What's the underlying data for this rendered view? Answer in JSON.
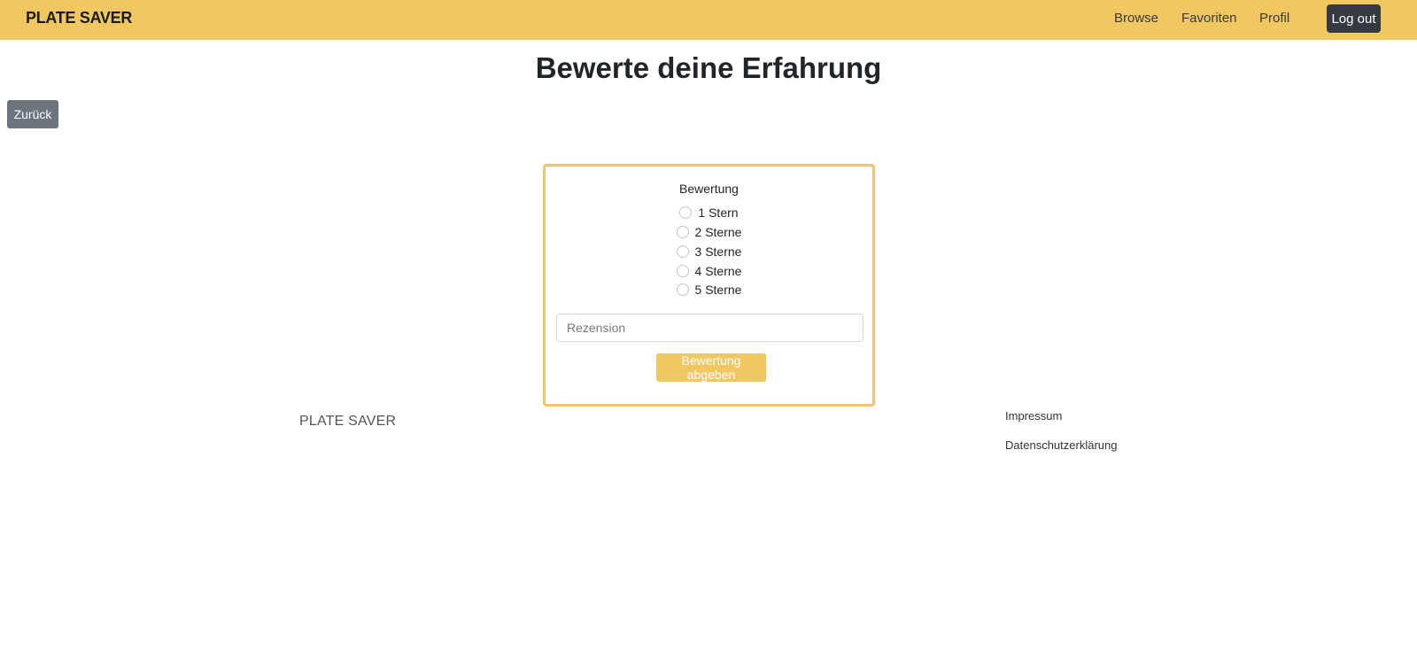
{
  "navbar": {
    "brand": "PLATE SAVER",
    "links": [
      "Browse",
      "Favoriten",
      "Profil"
    ],
    "logout_label": "Log out"
  },
  "page": {
    "title": "Bewerte deine Erfahrung",
    "back_label": "Zurück"
  },
  "form": {
    "label": "Bewertung",
    "options": [
      "1 Stern",
      "2 Sterne",
      "3 Sterne",
      "4 Sterne",
      "5 Sterne"
    ],
    "review_placeholder": "Rezension",
    "submit_label": "Bewertung abgeben"
  },
  "footer": {
    "brand": "PLATE SAVER",
    "links": [
      "Impressum",
      "Datenschutzerklärung"
    ]
  },
  "colors": {
    "accent": "#f0c760",
    "dark_button": "#343a40",
    "secondary_button": "#6c757d"
  }
}
